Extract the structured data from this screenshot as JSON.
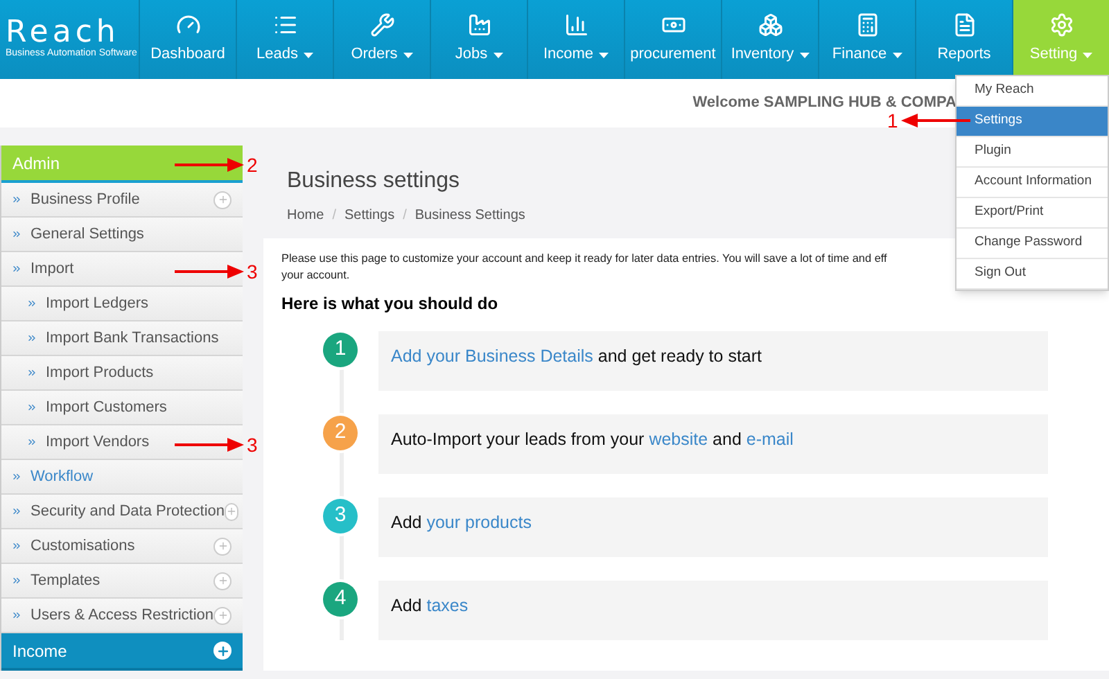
{
  "logo": {
    "name": "Reach",
    "tagline": "Business Automation Software"
  },
  "nav": [
    {
      "label": "Dashboard",
      "dropdown": false,
      "selected": false
    },
    {
      "label": "Leads",
      "dropdown": true,
      "selected": false
    },
    {
      "label": "Orders",
      "dropdown": true,
      "selected": false
    },
    {
      "label": "Jobs",
      "dropdown": true,
      "selected": false
    },
    {
      "label": "Income",
      "dropdown": true,
      "selected": false
    },
    {
      "label": "procurement",
      "dropdown": false,
      "selected": false
    },
    {
      "label": "Inventory",
      "dropdown": true,
      "selected": false
    },
    {
      "label": "Finance",
      "dropdown": true,
      "selected": false
    },
    {
      "label": "Reports",
      "dropdown": false,
      "selected": false
    },
    {
      "label": "Setting",
      "dropdown": true,
      "selected": true
    }
  ],
  "welcome": "Welcome SAMPLING HUB & COMPA",
  "menu": [
    {
      "label": "My Reach",
      "selected": false
    },
    {
      "label": "Settings",
      "selected": true
    },
    {
      "label": "Plugin",
      "selected": false
    },
    {
      "label": "Account Information",
      "selected": false
    },
    {
      "label": "Export/Print",
      "selected": false
    },
    {
      "label": "Change Password",
      "selected": false
    },
    {
      "label": "Sign Out",
      "selected": false
    }
  ],
  "sidebar": [
    {
      "title": "Admin",
      "expanded": true,
      "items": [
        {
          "label": "Business Profile",
          "plus": true,
          "selected": false
        },
        {
          "label": "General Settings",
          "plus": false,
          "selected": false
        },
        {
          "label": "Import",
          "plus": false,
          "selected": false,
          "children": [
            {
              "label": "Import Ledgers",
              "plus": false,
              "selected": false
            },
            {
              "label": "Import Bank Transactions",
              "plus": false,
              "selected": false
            },
            {
              "label": "Import Products",
              "plus": false,
              "selected": false
            },
            {
              "label": "Import Customers",
              "plus": false,
              "selected": false
            },
            {
              "label": "Import Vendors",
              "plus": false,
              "selected": false
            }
          ]
        },
        {
          "label": "Workflow",
          "plus": false,
          "selected": true
        },
        {
          "label": "Security and Data Protection",
          "plus": true,
          "selected": false
        },
        {
          "label": "Customisations",
          "plus": true,
          "selected": false
        },
        {
          "label": "Templates",
          "plus": true,
          "selected": false
        },
        {
          "label": "Users & Access Restriction",
          "plus": true,
          "selected": false
        }
      ]
    },
    {
      "title": "Income",
      "expanded": false
    }
  ],
  "page": {
    "title": "Business settings",
    "breadcrumb": [
      "Home",
      "Settings",
      "Business Settings"
    ],
    "breadcrumb_separator": "/",
    "intro": [
      "Please use this page to customize your account and keep it ready for later data entries. You will save a lot of time and eff",
      "your account."
    ],
    "heading": "Here is what you should do",
    "steps": [
      {
        "number": "1",
        "color": "#1aa67f",
        "parts": [
          {
            "text": "Add your Business Details",
            "link": true
          },
          {
            "text": " and get ready to start",
            "link": false
          }
        ]
      },
      {
        "number": "2",
        "color": "#f6a24a",
        "parts": [
          {
            "text": "Auto-Import your leads from your ",
            "link": false
          },
          {
            "text": "website",
            "link": true
          },
          {
            "text": " and ",
            "link": false
          },
          {
            "text": "e-mail",
            "link": true
          }
        ]
      },
      {
        "number": "3",
        "color": "#26bfc8",
        "parts": [
          {
            "text": "Add ",
            "link": false
          },
          {
            "text": "your products",
            "link": true
          }
        ]
      },
      {
        "number": "4",
        "color": "#1aa67f",
        "parts": [
          {
            "text": "Add ",
            "link": false
          },
          {
            "text": "taxes",
            "link": true
          }
        ]
      }
    ]
  },
  "annotations": [
    {
      "label": "1"
    },
    {
      "label": "2"
    },
    {
      "label": "3"
    },
    {
      "label": "3"
    }
  ]
}
